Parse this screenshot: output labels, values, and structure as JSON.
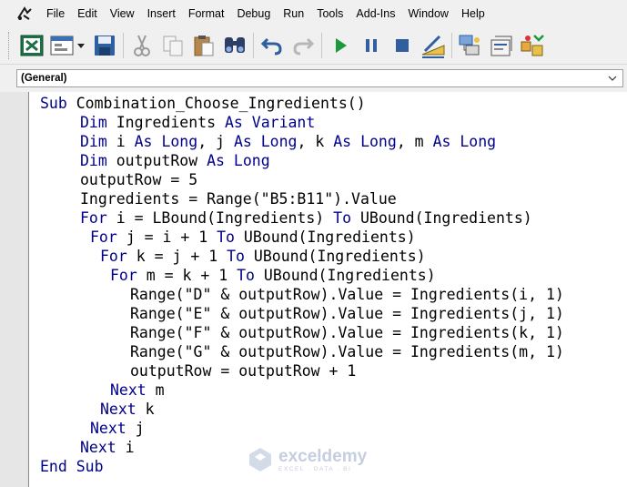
{
  "menu": {
    "items": [
      "File",
      "Edit",
      "View",
      "Insert",
      "Format",
      "Debug",
      "Run",
      "Tools",
      "Add-Ins",
      "Window",
      "Help"
    ]
  },
  "toolbar": {
    "icons": [
      "excel-view-icon",
      "insert-userform-icon",
      "save-icon",
      "cut-icon",
      "copy-icon",
      "paste-icon",
      "find-icon",
      "undo-icon",
      "redo-icon",
      "run-icon",
      "break-icon",
      "reset-icon",
      "design-mode-icon",
      "project-explorer-icon",
      "properties-icon",
      "object-browser-icon"
    ]
  },
  "object_combo": {
    "value": "(General)"
  },
  "code": {
    "lines": [
      {
        "indent": 0,
        "segments": [
          {
            "t": "Sub",
            "kw": true
          },
          {
            "t": " Combination_Choose_Ingredients()",
            "kw": false
          }
        ]
      },
      {
        "indent": 4,
        "segments": [
          {
            "t": "Dim",
            "kw": true
          },
          {
            "t": " Ingredients ",
            "kw": false
          },
          {
            "t": "As",
            "kw": true
          },
          {
            "t": " ",
            "kw": false
          },
          {
            "t": "Variant",
            "kw": true
          }
        ]
      },
      {
        "indent": 4,
        "segments": [
          {
            "t": "Dim",
            "kw": true
          },
          {
            "t": " i ",
            "kw": false
          },
          {
            "t": "As",
            "kw": true
          },
          {
            "t": " ",
            "kw": false
          },
          {
            "t": "Long",
            "kw": true
          },
          {
            "t": ", j ",
            "kw": false
          },
          {
            "t": "As",
            "kw": true
          },
          {
            "t": " ",
            "kw": false
          },
          {
            "t": "Long",
            "kw": true
          },
          {
            "t": ", k ",
            "kw": false
          },
          {
            "t": "As",
            "kw": true
          },
          {
            "t": " ",
            "kw": false
          },
          {
            "t": "Long",
            "kw": true
          },
          {
            "t": ", m ",
            "kw": false
          },
          {
            "t": "As",
            "kw": true
          },
          {
            "t": " ",
            "kw": false
          },
          {
            "t": "Long",
            "kw": true
          }
        ]
      },
      {
        "indent": 4,
        "segments": [
          {
            "t": "Dim",
            "kw": true
          },
          {
            "t": " outputRow ",
            "kw": false
          },
          {
            "t": "As",
            "kw": true
          },
          {
            "t": " ",
            "kw": false
          },
          {
            "t": "Long",
            "kw": true
          }
        ]
      },
      {
        "indent": 4,
        "segments": [
          {
            "t": "outputRow = 5",
            "kw": false
          }
        ]
      },
      {
        "indent": 4,
        "segments": [
          {
            "t": "Ingredients = Range(\"B5:B11\").Value",
            "kw": false
          }
        ]
      },
      {
        "indent": 4,
        "segments": [
          {
            "t": "For",
            "kw": true
          },
          {
            "t": " i = LBound(Ingredients) ",
            "kw": false
          },
          {
            "t": "To",
            "kw": true
          },
          {
            "t": " UBound(Ingredients)",
            "kw": false
          }
        ]
      },
      {
        "indent": 5,
        "segments": [
          {
            "t": "For",
            "kw": true
          },
          {
            "t": " j = i + 1 ",
            "kw": false
          },
          {
            "t": "To",
            "kw": true
          },
          {
            "t": " UBound(Ingredients)",
            "kw": false
          }
        ]
      },
      {
        "indent": 6,
        "segments": [
          {
            "t": "For",
            "kw": true
          },
          {
            "t": " k = j + 1 ",
            "kw": false
          },
          {
            "t": "To",
            "kw": true
          },
          {
            "t": " UBound(Ingredients)",
            "kw": false
          }
        ]
      },
      {
        "indent": 7,
        "segments": [
          {
            "t": "For",
            "kw": true
          },
          {
            "t": " m = k + 1 ",
            "kw": false
          },
          {
            "t": "To",
            "kw": true
          },
          {
            "t": " UBound(Ingredients)",
            "kw": false
          }
        ]
      },
      {
        "indent": 9,
        "segments": [
          {
            "t": "Range(\"D\" & outputRow).Value = Ingredients(i, 1)",
            "kw": false
          }
        ]
      },
      {
        "indent": 9,
        "segments": [
          {
            "t": "Range(\"E\" & outputRow).Value = Ingredients(j, 1)",
            "kw": false
          }
        ]
      },
      {
        "indent": 9,
        "segments": [
          {
            "t": "Range(\"F\" & outputRow).Value = Ingredients(k, 1)",
            "kw": false
          }
        ]
      },
      {
        "indent": 9,
        "segments": [
          {
            "t": "Range(\"G\" & outputRow).Value = Ingredients(m, 1)",
            "kw": false
          }
        ]
      },
      {
        "indent": 9,
        "segments": [
          {
            "t": "outputRow = outputRow + 1",
            "kw": false
          }
        ]
      },
      {
        "indent": 7,
        "segments": [
          {
            "t": "Next",
            "kw": true
          },
          {
            "t": " m",
            "kw": false
          }
        ]
      },
      {
        "indent": 6,
        "segments": [
          {
            "t": "Next",
            "kw": true
          },
          {
            "t": " k",
            "kw": false
          }
        ]
      },
      {
        "indent": 5,
        "segments": [
          {
            "t": "Next",
            "kw": true
          },
          {
            "t": " j",
            "kw": false
          }
        ]
      },
      {
        "indent": 4,
        "segments": [
          {
            "t": "Next",
            "kw": true
          },
          {
            "t": " i",
            "kw": false
          }
        ]
      },
      {
        "indent": 0,
        "segments": [
          {
            "t": "End",
            "kw": true
          },
          {
            "t": " ",
            "kw": false
          },
          {
            "t": "Sub",
            "kw": true
          }
        ]
      }
    ]
  },
  "watermark": {
    "brand": "exceldemy",
    "tagline": "EXCEL · DATA · BI"
  },
  "colors": {
    "keyword": "#00008b",
    "text": "#000000",
    "chrome": "#f0f0f0"
  }
}
